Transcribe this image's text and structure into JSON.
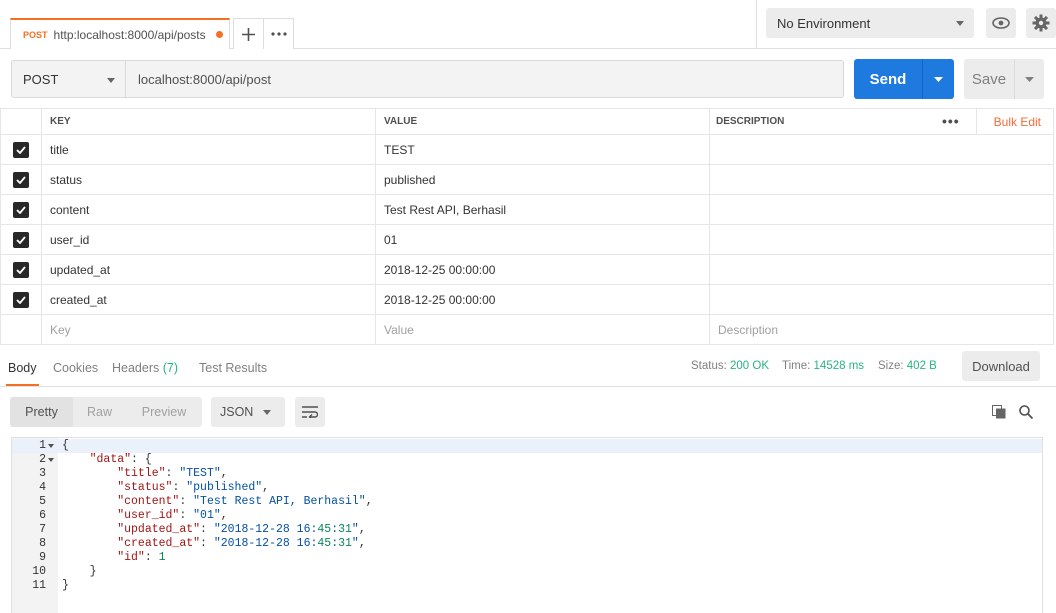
{
  "tabs": [
    {
      "method": "POST",
      "url": "http:localhost:8000/api/posts",
      "modified": true
    }
  ],
  "environment": {
    "selected": "No Environment"
  },
  "request": {
    "method": "POST",
    "url": "localhost:8000/api/post",
    "send_label": "Send",
    "save_label": "Save"
  },
  "params": {
    "headers": {
      "key": "KEY",
      "value": "VALUE",
      "description": "DESCRIPTION",
      "bulk_edit": "Bulk Edit"
    },
    "rows": [
      {
        "checked": true,
        "key": "title",
        "value": "TEST",
        "description": ""
      },
      {
        "checked": true,
        "key": "status",
        "value": "published",
        "description": ""
      },
      {
        "checked": true,
        "key": "content",
        "value": "Test Rest API, Berhasil",
        "description": ""
      },
      {
        "checked": true,
        "key": "user_id",
        "value": "01",
        "description": ""
      },
      {
        "checked": true,
        "key": "updated_at",
        "value": "2018-12-25 00:00:00",
        "description": ""
      },
      {
        "checked": true,
        "key": "created_at",
        "value": "2018-12-25 00:00:00",
        "description": ""
      }
    ],
    "placeholders": {
      "key": "Key",
      "value": "Value",
      "description": "Description"
    }
  },
  "response": {
    "tabs": {
      "body": "Body",
      "cookies": "Cookies",
      "headers": "Headers",
      "headers_count": "(7)",
      "tests": "Test Results"
    },
    "status_label": "Status:",
    "status_value": "200 OK",
    "time_label": "Time:",
    "time_value": "14528 ms",
    "size_label": "Size:",
    "size_value": "402 B",
    "download_label": "Download",
    "format_tabs": {
      "pretty": "Pretty",
      "raw": "Raw",
      "preview": "Preview"
    },
    "language": "JSON",
    "body_lines": [
      "{",
      "    \"data\": {",
      "        \"title\": \"TEST\",",
      "        \"status\": \"published\",",
      "        \"content\": \"Test Rest API, Berhasil\",",
      "        \"user_id\": \"01\",",
      "        \"updated_at\": \"2018-12-28 16:45:31\",",
      "        \"created_at\": \"2018-12-28 16:45:31\",",
      "        \"id\": 1",
      "    }",
      "}"
    ]
  },
  "colors": {
    "accent": "#f47023",
    "send": "#1f7ae0",
    "success": "#26b47f"
  }
}
